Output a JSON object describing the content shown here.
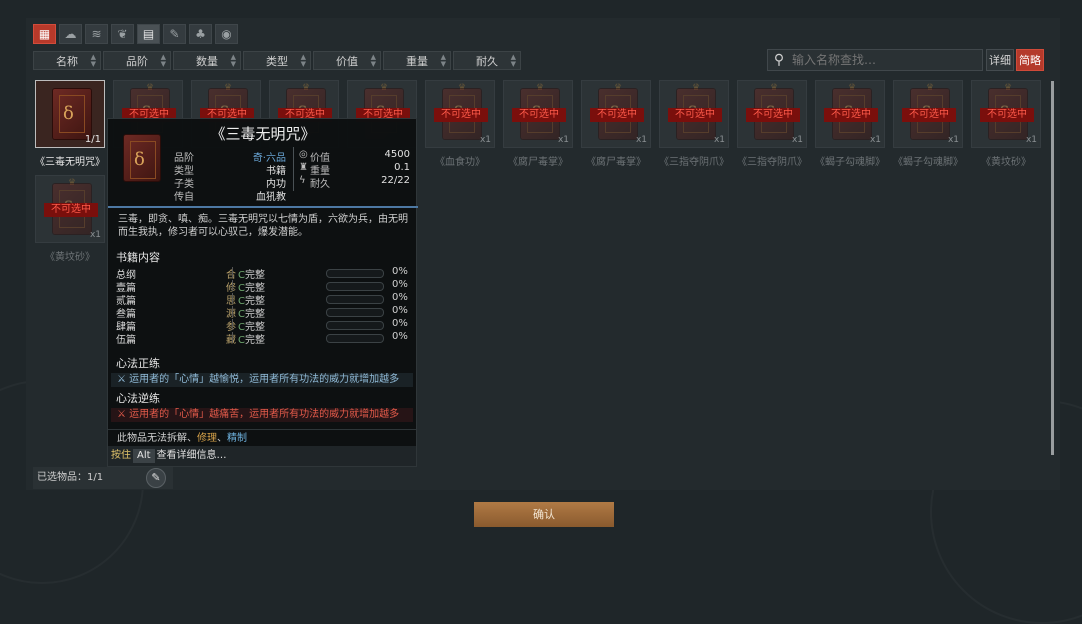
{
  "filter_tabs": [
    {
      "icon": "grid-icon",
      "glyph": "▦",
      "state": "active"
    },
    {
      "icon": "cloud-icon",
      "glyph": "☁",
      "state": ""
    },
    {
      "icon": "wind-icon",
      "glyph": "≋",
      "state": ""
    },
    {
      "icon": "herb-icon",
      "glyph": "❦",
      "state": ""
    },
    {
      "icon": "book-icon",
      "glyph": "▤",
      "state": "sel"
    },
    {
      "icon": "scroll-icon",
      "glyph": "✎",
      "state": ""
    },
    {
      "icon": "gourd-icon",
      "glyph": "♣",
      "state": ""
    },
    {
      "icon": "eye-icon",
      "glyph": "◉",
      "state": ""
    }
  ],
  "sort_columns": [
    "名称",
    "品阶",
    "数量",
    "类型",
    "价值",
    "重量",
    "耐久"
  ],
  "search": {
    "placeholder": "输入名称查找…"
  },
  "view_buttons": {
    "detail": "详细",
    "simple": "简略"
  },
  "locked_label": "不可选中",
  "items": [
    {
      "name": "《三毒无明咒》",
      "count": "1/1",
      "locked": false
    },
    {
      "name": "",
      "count": "",
      "locked": true
    },
    {
      "name": "",
      "count": "",
      "locked": true
    },
    {
      "name": "",
      "count": "",
      "locked": true
    },
    {
      "name": "",
      "count": "",
      "locked": true
    },
    {
      "name": "《血食功》",
      "count": "x1",
      "locked": true
    },
    {
      "name": "《腐尸毒掌》",
      "count": "x1",
      "locked": true
    },
    {
      "name": "《腐尸毒掌》",
      "count": "x1",
      "locked": true
    },
    {
      "name": "《三指夺阴爪》",
      "count": "x1",
      "locked": true
    },
    {
      "name": "《三指夺阴爪》",
      "count": "x1",
      "locked": true
    },
    {
      "name": "《蝎子勾魂脚》",
      "count": "x1",
      "locked": true
    },
    {
      "name": "《蝎子勾魂脚》",
      "count": "x1",
      "locked": true
    },
    {
      "name": "《黄坟砂》",
      "count": "x1",
      "locked": true
    },
    {
      "name": "《黄坟砂》",
      "count": "x1",
      "locked": true
    }
  ],
  "tooltip": {
    "title": "《三毒无明咒》",
    "attrs_left": [
      {
        "k": "品阶",
        "v": "奇·六品"
      },
      {
        "k": "类型",
        "v": "书籍"
      },
      {
        "k": "子类",
        "v": "内功"
      },
      {
        "k": "传自",
        "v": "血犼教"
      }
    ],
    "attrs_right": [
      {
        "icon": "value-icon",
        "glyph": "◎",
        "k": "价值",
        "v": "4500"
      },
      {
        "icon": "weight-icon",
        "glyph": "♜",
        "k": "重量",
        "v": "0.1"
      },
      {
        "icon": "durability-icon",
        "glyph": "ϟ",
        "k": "耐久",
        "v": "22/22"
      }
    ],
    "description": "三毒，即贪、嗔、痴。三毒无明咒以七情为盾，六欲为兵，由无明而生我执，修习者可以心驭己，爆发潜能。",
    "chapters_title": "书籍内容",
    "chapters": [
      {
        "name": "总纲",
        "char": "合",
        "status": "完整",
        "pct": "0%",
        "progress": 0
      },
      {
        "name": "壹篇",
        "char": "修",
        "status": "完整",
        "pct": "0%",
        "progress": 0
      },
      {
        "name": "贰篇",
        "char": "思",
        "status": "完整",
        "pct": "0%",
        "progress": 0
      },
      {
        "name": "叁篇",
        "char": "源",
        "status": "完整",
        "pct": "0%",
        "progress": 0
      },
      {
        "name": "肆篇",
        "char": "参",
        "status": "完整",
        "pct": "0%",
        "progress": 0
      },
      {
        "name": "伍篇",
        "char": "藏",
        "status": "完整",
        "pct": "0%",
        "progress": 0
      }
    ],
    "positive_title": "心法正练",
    "positive_text": "运用者的「心情」越愉悦，运用者所有功法的威力就增加越多",
    "negative_title": "心法逆练",
    "negative_text": "运用者的「心情」越痛苦，运用者所有功法的威力就增加越多",
    "hint_prefix": "此物品无法拆解、",
    "hint_repair": "修理",
    "hint_sep": "、",
    "hint_refine": "精制",
    "hint2_press": "按住",
    "hint2_key": "Alt",
    "hint2_text": "查看详细信息…"
  },
  "selected_label": "已选物品：1/1",
  "confirm_label": "确认",
  "colors": {
    "accent": "#b8392a",
    "confirm": "#a06c3a",
    "blue": "#6aa7d8",
    "negative": "#e25a4a"
  }
}
